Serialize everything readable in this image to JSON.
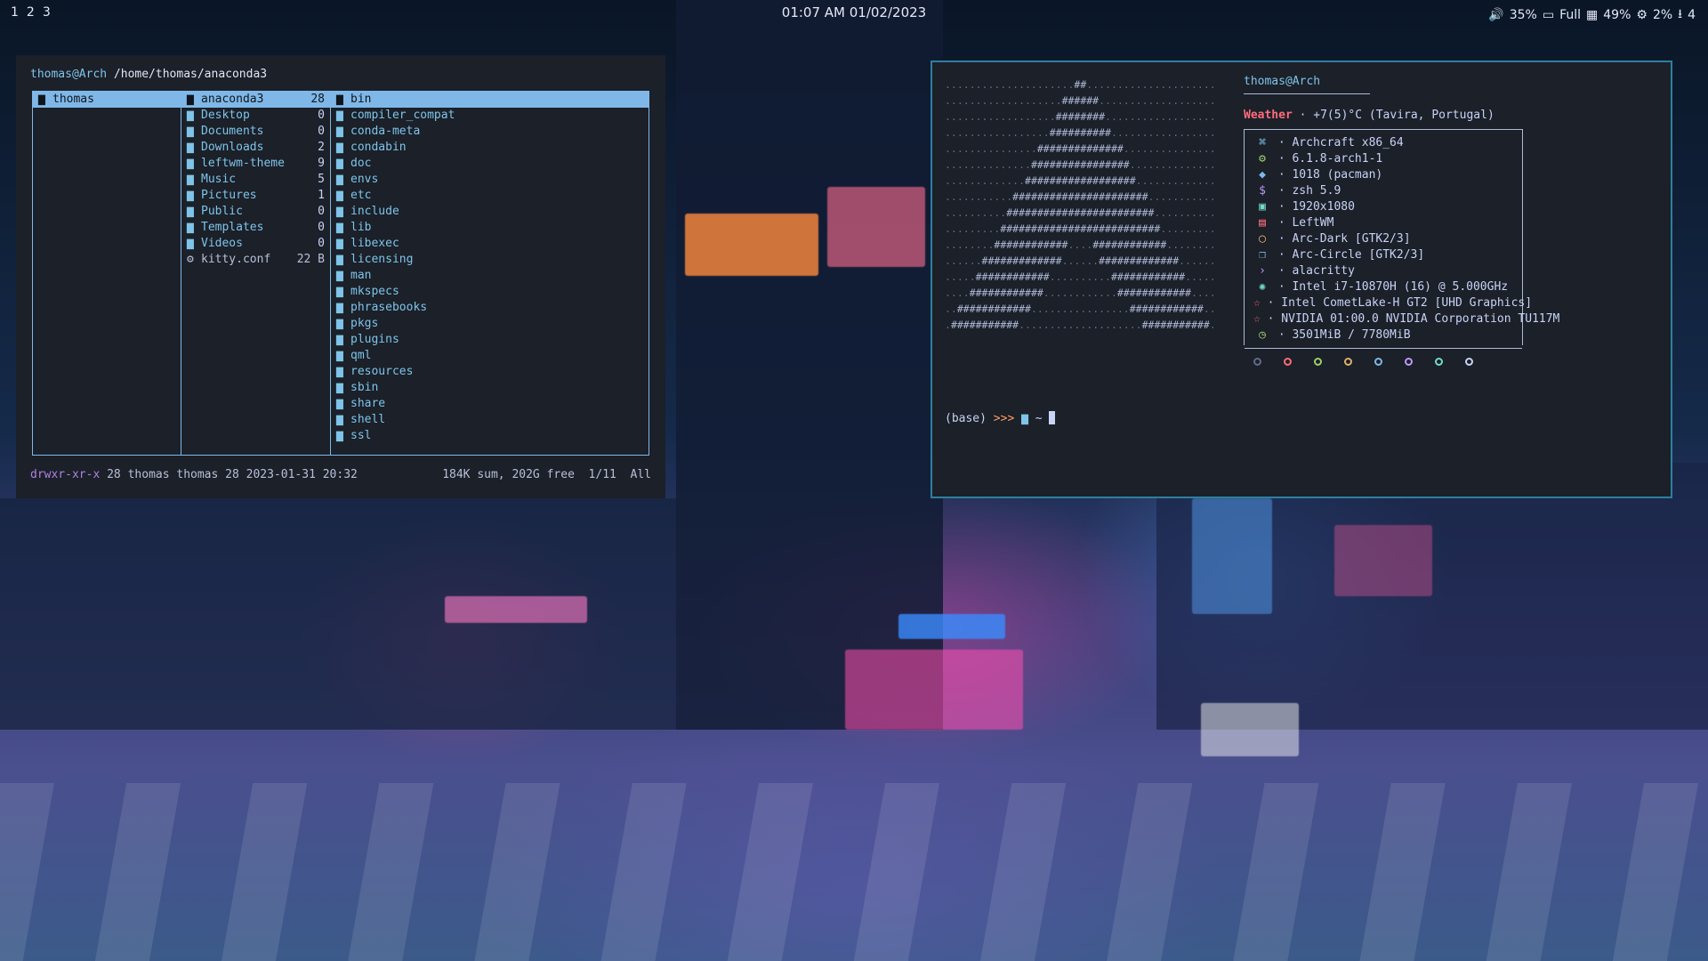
{
  "topbar": {
    "workspaces": [
      "1",
      "2",
      "3"
    ],
    "clock": "01:07 AM  01/02/2023",
    "volume": "35%",
    "battery_label": "Full",
    "memory": "49%",
    "cpu": "2%",
    "updates": "4"
  },
  "ranger": {
    "user": "thomas@Arch",
    "path": "/home/thomas/anaconda3",
    "pane1": [
      {
        "name": "thomas",
        "selected": true
      }
    ],
    "pane2": [
      {
        "name": "anaconda3",
        "count": "28",
        "selected": true
      },
      {
        "name": "Desktop",
        "count": "0"
      },
      {
        "name": "Documents",
        "count": "0"
      },
      {
        "name": "Downloads",
        "count": "2"
      },
      {
        "name": "leftwm-theme",
        "count": "9"
      },
      {
        "name": "Music",
        "count": "5"
      },
      {
        "name": "Pictures",
        "count": "1"
      },
      {
        "name": "Public",
        "count": "0"
      },
      {
        "name": "Templates",
        "count": "0"
      },
      {
        "name": "Videos",
        "count": "0"
      },
      {
        "name": "kitty.conf",
        "count": "22 B",
        "file": true
      }
    ],
    "pane3": [
      "bin",
      "compiler_compat",
      "conda-meta",
      "condabin",
      "doc",
      "envs",
      "etc",
      "include",
      "lib",
      "libexec",
      "licensing",
      "man",
      "mkspecs",
      "phrasebooks",
      "pkgs",
      "plugins",
      "qml",
      "resources",
      "sbin",
      "share",
      "shell",
      "ssl"
    ],
    "status_perm": "drwxr-xr-x",
    "status_meta": " 28 thomas thomas 28 2023-01-31 20:32",
    "status_right": "184K sum, 202G free  1/11  All"
  },
  "fetch": {
    "host": "thomas@Arch",
    "weather_label": "Weather",
    "weather_value": " · +7(5)°C (Tavira, Portugal)",
    "rows": [
      {
        "icon": "⌘",
        "color": "#7fc4e8",
        "text": " · Archcraft x86_64"
      },
      {
        "icon": "⚙",
        "color": "#9ece6a",
        "text": " · 6.1.8-arch1-1"
      },
      {
        "icon": "◆",
        "color": "#7fb8e8",
        "text": " · 1018 (pacman)"
      },
      {
        "icon": "$",
        "color": "#bb9af7",
        "text": " · zsh 5.9"
      },
      {
        "icon": "▣",
        "color": "#73daca",
        "text": " · 1920x1080"
      },
      {
        "icon": "▤",
        "color": "#ff6b7a",
        "text": " · LeftWM"
      },
      {
        "icon": "◯",
        "color": "#e0af68",
        "text": " · Arc-Dark [GTK2/3]"
      },
      {
        "icon": "❐",
        "color": "#7fb8e8",
        "text": " · Arc-Circle [GTK2/3]"
      },
      {
        "icon": "›",
        "color": "#bb9af7",
        "text": " · alacritty"
      },
      {
        "icon": "✺",
        "color": "#73daca",
        "text": " · Intel i7-10870H (16) @ 5.000GHz"
      },
      {
        "icon": "☆",
        "color": "#ff6b7a",
        "text": " · Intel CometLake-H GT2 [UHD Graphics]"
      },
      {
        "icon": "☆",
        "color": "#ff6b7a",
        "text": " · NVIDIA 01:00.0 NVIDIA Corporation TU117M"
      },
      {
        "icon": "◷",
        "color": "#9ece6a",
        "text": " · 3501MiB / 7780MiB"
      }
    ],
    "palette": [
      "#5f6b8a",
      "#ff6b7a",
      "#9ece6a",
      "#e0af68",
      "#7fb8e8",
      "#bb9af7",
      "#73daca",
      "#c8d3f5"
    ],
    "prompt_env": "(base) ",
    "prompt_arrow": ">>>",
    "prompt_dir": " ~ "
  }
}
